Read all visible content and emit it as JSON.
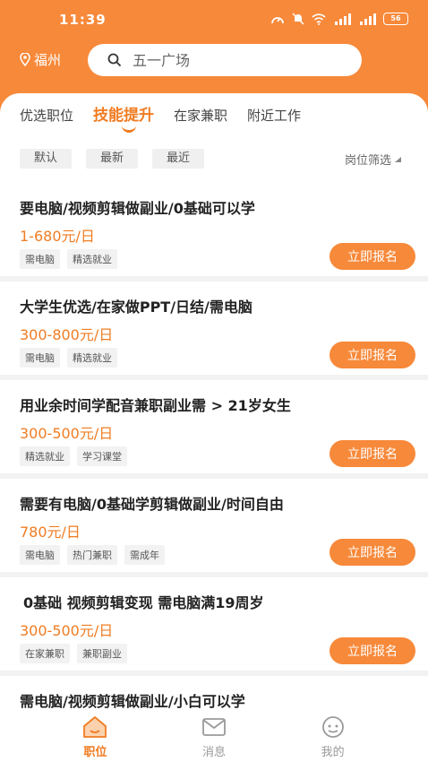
{
  "status": {
    "time": "11:39",
    "signal1": "4G",
    "signal2": "4G",
    "battery": "56"
  },
  "location": "福州",
  "search": {
    "placeholder": "五一广场"
  },
  "tabs": [
    "优选职位",
    "技能提升",
    "在家兼职",
    "附近工作"
  ],
  "filters": {
    "chips": [
      "默认",
      "最新",
      "最近"
    ],
    "dropdown": "岗位筛选"
  },
  "jobs": [
    {
      "title": "要电脑/视频剪辑做副业/0基础可以学",
      "salary": "1-680元/日",
      "tags": [
        "需电脑",
        "精选就业"
      ],
      "button": "立即报名"
    },
    {
      "title": "大学生优选/在家做PPT/日结/需电脑",
      "salary": "300-800元/日",
      "tags": [
        "需电脑",
        "精选就业"
      ],
      "button": "立即报名"
    },
    {
      "title": "用业余时间学配音兼职副业需 > 21岁女生",
      "salary": "300-500元/日",
      "tags": [
        "精选就业",
        "学习课堂"
      ],
      "button": "立即报名"
    },
    {
      "title": "需要有电脑/0基础学剪辑做副业/时间自由",
      "salary": "780元/日",
      "tags": [
        "需电脑",
        "热门兼职",
        "需成年"
      ],
      "button": "立即报名"
    },
    {
      "title": "0基础 视频剪辑变现 需电脑满19周岁",
      "salary": "300-500元/日",
      "tags": [
        "在家兼职",
        "兼职副业"
      ],
      "button": "立即报名"
    },
    {
      "title": "需电脑/视频剪辑做副业/小白可以学",
      "salary": "",
      "tags": [],
      "button": ""
    }
  ],
  "nav": [
    {
      "label": "职位",
      "icon": "home-icon"
    },
    {
      "label": "消息",
      "icon": "mail-icon"
    },
    {
      "label": "我的",
      "icon": "profile-icon"
    }
  ],
  "colors": {
    "accent": "#f7893a",
    "accent_text": "#f07c22"
  }
}
